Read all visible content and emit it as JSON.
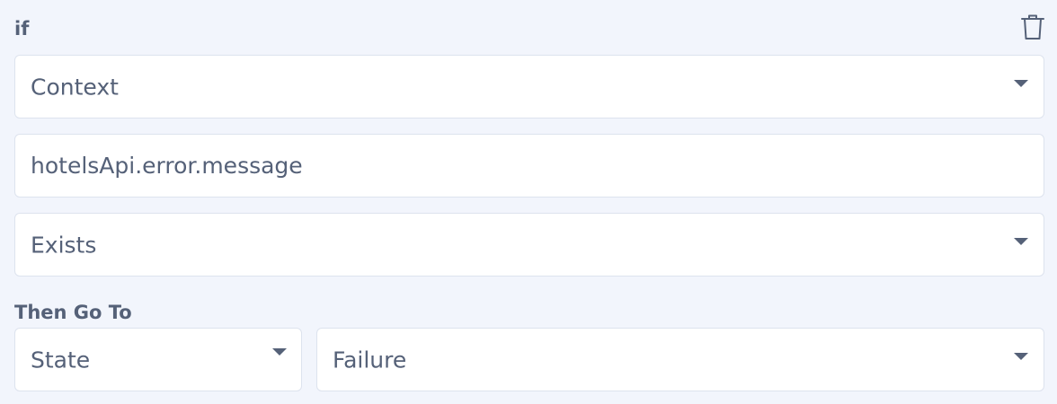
{
  "condition": {
    "if_label": "if",
    "delete_icon": "trash-icon",
    "source": {
      "value": "Context"
    },
    "path": {
      "value": "hotelsApi.error.message"
    },
    "operator": {
      "value": "Exists"
    }
  },
  "then": {
    "label": "Then Go To",
    "target_type": {
      "value": "State"
    },
    "target": {
      "value": "Failure"
    }
  },
  "colors": {
    "background": "#f2f5fc",
    "field_background": "#ffffff",
    "field_border": "#dde3ee",
    "text": "#556178"
  }
}
